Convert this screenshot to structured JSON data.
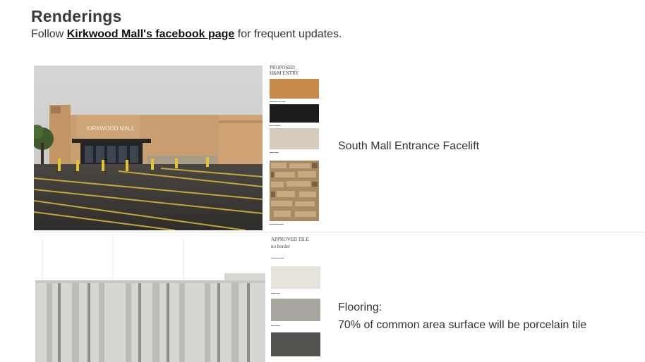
{
  "header": {
    "title": "Renderings",
    "intro_prefix": "Follow ",
    "intro_link": "Kirkwood Mall's facebook page",
    "intro_suffix": " for frequent updates."
  },
  "rendering_1": {
    "photo_sign": "KIRKWOOD MALL",
    "panel_title_line1": "PROPOSED",
    "panel_title_line2": "H&M ENTRY",
    "swatch_colors": [
      "#c88b4c",
      "#1c1c1e",
      "#d6ccbd",
      "#a88a63"
    ],
    "caption": "South Mall Entrance Facelift"
  },
  "rendering_2": {
    "panel_title": "APPROVED TILE",
    "panel_sub": "no border",
    "swatch_colors": [
      "#e6e2dc",
      "#a9a6a1",
      "#545350"
    ],
    "caption_line1": "Flooring:",
    "caption_line2": "70% of common area surface will be porcelain tile"
  }
}
